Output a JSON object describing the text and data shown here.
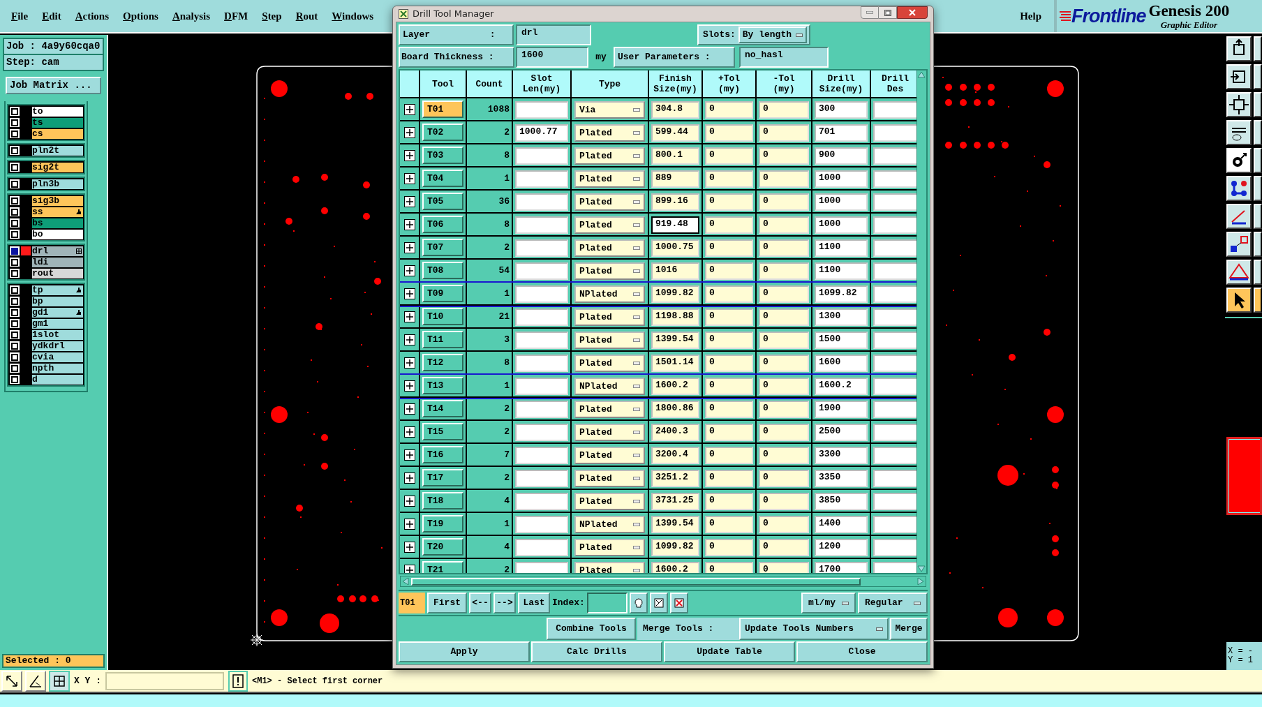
{
  "menu_bar": {
    "items": [
      "File",
      "Edit",
      "Actions",
      "Options",
      "Analysis",
      "DFM",
      "Step",
      "Rout",
      "Windows"
    ],
    "help": "Help",
    "logo": "Frontline",
    "product": "Genesis 200",
    "subtitle": "Graphic Editor"
  },
  "left_panel": {
    "job": "Job : 4a9y60cqa0",
    "step": "Step: cam",
    "job_matrix": "Job Matrix ...",
    "selected_count": "Selected : 0",
    "layer_groups": [
      {
        "layers": [
          {
            "name": "to",
            "color": "#ffffff",
            "active": false,
            "pointer": false
          },
          {
            "name": "ts",
            "color": "#0e9e78",
            "active": false,
            "pointer": false
          },
          {
            "name": "cs",
            "color": "#fec55a",
            "active": false,
            "pointer": false
          }
        ]
      },
      {
        "layers": [
          {
            "name": "pln2t",
            "color": "#9fdcdc",
            "active": false,
            "pointer": false
          }
        ]
      },
      {
        "layers": [
          {
            "name": "sig2t",
            "color": "#fec55a",
            "active": false,
            "pointer": false
          }
        ]
      },
      {
        "layers": [
          {
            "name": "pln3b",
            "color": "#9fdcdc",
            "active": false,
            "pointer": false
          }
        ]
      },
      {
        "layers": [
          {
            "name": "sig3b",
            "color": "#fec55a",
            "active": false,
            "pointer": false
          },
          {
            "name": "ss",
            "color": "#fec55a",
            "active": false,
            "pointer": true
          },
          {
            "name": "bs",
            "color": "#0e9e78",
            "active": false,
            "pointer": false
          },
          {
            "name": "bo",
            "color": "#ffffff",
            "active": false,
            "pointer": false
          }
        ]
      },
      {
        "layers": [
          {
            "name": "drl",
            "color": "#a0b4b8",
            "active": true,
            "pointer": false
          },
          {
            "name": "ldi",
            "color": "#a0b4b8",
            "active": false,
            "pointer": false
          },
          {
            "name": "rout",
            "color": "#d8d8d8",
            "active": false,
            "pointer": false
          }
        ]
      },
      {
        "layers": [
          {
            "name": "tp",
            "color": "#9fdcdc",
            "active": false,
            "pointer": true
          },
          {
            "name": "bp",
            "color": "#9fdcdc",
            "active": false,
            "pointer": false
          },
          {
            "name": "gd1",
            "color": "#9fdcdc",
            "active": false,
            "pointer": true
          },
          {
            "name": "gm1",
            "color": "#9fdcdc",
            "active": false,
            "pointer": false
          },
          {
            "name": "1slot",
            "color": "#9fdcdc",
            "active": false,
            "pointer": false
          },
          {
            "name": "ydkdrl",
            "color": "#9fdcdc",
            "active": false,
            "pointer": false
          },
          {
            "name": "cvia",
            "color": "#9fdcdc",
            "active": false,
            "pointer": false
          },
          {
            "name": "npth",
            "color": "#9fdcdc",
            "active": false,
            "pointer": false
          },
          {
            "name": "d",
            "color": "#9fdcdc",
            "active": false,
            "pointer": false
          }
        ]
      }
    ]
  },
  "dialog": {
    "title": "Drill Tool Manager",
    "layer_label": "Layer           :",
    "layer_value": "drl",
    "slots_label": "Slots:",
    "slots_value": "By length",
    "thickness_label": "Board Thickness :",
    "thickness_value": "1600",
    "thickness_unit": "my",
    "user_params_label": "User Parameters :",
    "user_params_value": "no_hasl",
    "columns": [
      "Tool",
      "Count",
      "Slot\nLen(my)",
      "Type",
      "Finish\nSize(my)",
      "+Tol\n(my)",
      "-Tol\n(my)",
      "Drill\nSize(my)",
      "Drill\nDes"
    ],
    "rows": [
      {
        "tool": "T01",
        "count": "1088",
        "type": "Via",
        "finish": "304.8",
        "plus_tol": "0",
        "minus_tol": "0",
        "drill": "300",
        "selected": true,
        "highlighted": false,
        "focused": false
      },
      {
        "tool": "T02",
        "count": "2",
        "slot": "1000.77",
        "type": "Plated",
        "finish": "599.44",
        "plus_tol": "0",
        "minus_tol": "0",
        "drill": "701",
        "selected": false,
        "highlighted": false,
        "focused": false
      },
      {
        "tool": "T03",
        "count": "8",
        "type": "Plated",
        "finish": "800.1",
        "plus_tol": "0",
        "minus_tol": "0",
        "drill": "900",
        "selected": false,
        "highlighted": false,
        "focused": false
      },
      {
        "tool": "T04",
        "count": "1",
        "type": "Plated",
        "finish": "889",
        "plus_tol": "0",
        "minus_tol": "0",
        "drill": "1000",
        "selected": false,
        "highlighted": false,
        "focused": false
      },
      {
        "tool": "T05",
        "count": "36",
        "type": "Plated",
        "finish": "899.16",
        "plus_tol": "0",
        "minus_tol": "0",
        "drill": "1000",
        "selected": false,
        "highlighted": false,
        "focused": false
      },
      {
        "tool": "T06",
        "count": "8",
        "type": "Plated",
        "finish": "919.48",
        "plus_tol": "0",
        "minus_tol": "0",
        "drill": "1000",
        "selected": false,
        "highlighted": false,
        "focused": true
      },
      {
        "tool": "T07",
        "count": "2",
        "type": "Plated",
        "finish": "1000.75",
        "plus_tol": "0",
        "minus_tol": "0",
        "drill": "1100",
        "selected": false,
        "highlighted": false,
        "focused": false
      },
      {
        "tool": "T08",
        "count": "54",
        "type": "Plated",
        "finish": "1016",
        "plus_tol": "0",
        "minus_tol": "0",
        "drill": "1100",
        "selected": false,
        "highlighted": false,
        "focused": false
      },
      {
        "tool": "T09",
        "count": "1",
        "type": "NPlated",
        "finish": "1099.82",
        "plus_tol": "0",
        "minus_tol": "0",
        "drill": "1099.82",
        "selected": false,
        "highlighted": true,
        "focused": false
      },
      {
        "tool": "T10",
        "count": "21",
        "type": "Plated",
        "finish": "1198.88",
        "plus_tol": "0",
        "minus_tol": "0",
        "drill": "1300",
        "selected": false,
        "highlighted": false,
        "focused": false
      },
      {
        "tool": "T11",
        "count": "3",
        "type": "Plated",
        "finish": "1399.54",
        "plus_tol": "0",
        "minus_tol": "0",
        "drill": "1500",
        "selected": false,
        "highlighted": false,
        "focused": false
      },
      {
        "tool": "T12",
        "count": "8",
        "type": "Plated",
        "finish": "1501.14",
        "plus_tol": "0",
        "minus_tol": "0",
        "drill": "1600",
        "selected": false,
        "highlighted": false,
        "focused": false
      },
      {
        "tool": "T13",
        "count": "1",
        "type": "NPlated",
        "finish": "1600.2",
        "plus_tol": "0",
        "minus_tol": "0",
        "drill": "1600.2",
        "selected": false,
        "highlighted": true,
        "focused": false
      },
      {
        "tool": "T14",
        "count": "2",
        "type": "Plated",
        "finish": "1800.86",
        "plus_tol": "0",
        "minus_tol": "0",
        "drill": "1900",
        "selected": false,
        "highlighted": false,
        "focused": false
      },
      {
        "tool": "T15",
        "count": "2",
        "type": "Plated",
        "finish": "2400.3",
        "plus_tol": "0",
        "minus_tol": "0",
        "drill": "2500",
        "selected": false,
        "highlighted": false,
        "focused": false
      },
      {
        "tool": "T16",
        "count": "7",
        "type": "Plated",
        "finish": "3200.4",
        "plus_tol": "0",
        "minus_tol": "0",
        "drill": "3300",
        "selected": false,
        "highlighted": false,
        "focused": false
      },
      {
        "tool": "T17",
        "count": "2",
        "type": "Plated",
        "finish": "3251.2",
        "plus_tol": "0",
        "minus_tol": "0",
        "drill": "3350",
        "selected": false,
        "highlighted": false,
        "focused": false
      },
      {
        "tool": "T18",
        "count": "4",
        "type": "Plated",
        "finish": "3731.25",
        "plus_tol": "0",
        "minus_tol": "0",
        "drill": "3850",
        "selected": false,
        "highlighted": false,
        "focused": false
      },
      {
        "tool": "T19",
        "count": "1",
        "type": "NPlated",
        "finish": "1399.54",
        "plus_tol": "0",
        "minus_tol": "0",
        "drill": "1400",
        "selected": false,
        "highlighted": false,
        "focused": false
      },
      {
        "tool": "T20",
        "count": "4",
        "type": "Plated",
        "finish": "1099.82",
        "plus_tol": "0",
        "minus_tol": "0",
        "drill": "1200",
        "selected": false,
        "highlighted": false,
        "focused": false
      },
      {
        "tool": "T21",
        "count": "2",
        "type": "Plated",
        "finish": "1600.2",
        "plus_tol": "0",
        "minus_tol": "0",
        "drill": "1700",
        "selected": false,
        "highlighted": false,
        "focused": false
      }
    ],
    "nav": {
      "current_tool": "T01",
      "first": "First",
      "prev": "<--",
      "next": "-->",
      "last": "Last",
      "index_label": "Index:",
      "units": "ml/my",
      "mode": "Regular"
    },
    "merge": {
      "combine": "Combine Tools",
      "label": "Merge Tools :",
      "option": "Update Tools Numbers",
      "merge": "Merge"
    },
    "buttons": [
      "Apply",
      "Calc Drills",
      "Update Table",
      "Close"
    ]
  },
  "right_panel": {
    "x_readout": "X = -",
    "y_readout": "Y = 1"
  },
  "status_bar": {
    "xy_label": "X Y :",
    "message": "<M1> - Select first corner"
  }
}
